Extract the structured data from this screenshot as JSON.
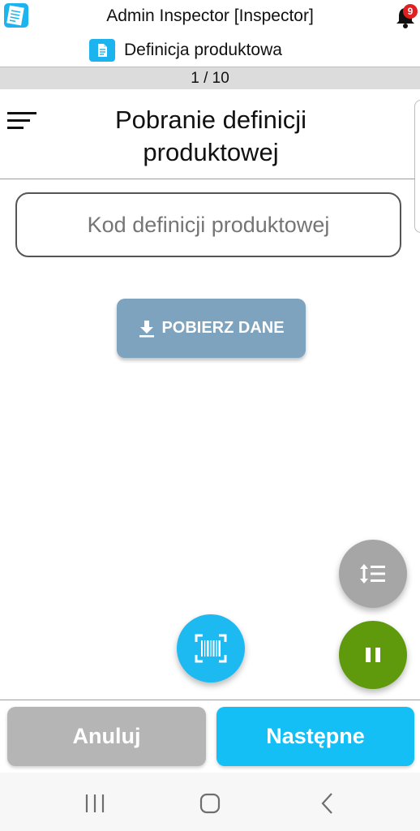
{
  "topbar": {
    "app_title": "Admin Inspector [Inspector]",
    "notification_count": "9"
  },
  "subheader": {
    "title": "Definicja produktowa"
  },
  "progress": {
    "text": "1 / 10"
  },
  "main": {
    "title": "Pobranie definicji produktowej",
    "code_input": {
      "placeholder": "Kod definicji produktowej",
      "value": ""
    },
    "download_button": {
      "label": "POBIERZ DANE",
      "icon": "download-icon"
    }
  },
  "fabs": {
    "sort_icon": "line-spacing-icon",
    "scan_icon": "barcode-scan-icon",
    "pause_icon": "pause-icon"
  },
  "actions": {
    "cancel_label": "Anuluj",
    "next_label": "Następne"
  },
  "system_nav": {
    "recent": "recent-apps-icon",
    "home": "home-icon",
    "back": "back-icon"
  },
  "colors": {
    "accent": "#13bff5",
    "disabled_button": "#7ea3bf",
    "cancel_button": "#b5b5b5",
    "pause_fab": "#5f9a0c",
    "sort_fab": "#a6a6a6",
    "badge": "#e02020"
  }
}
